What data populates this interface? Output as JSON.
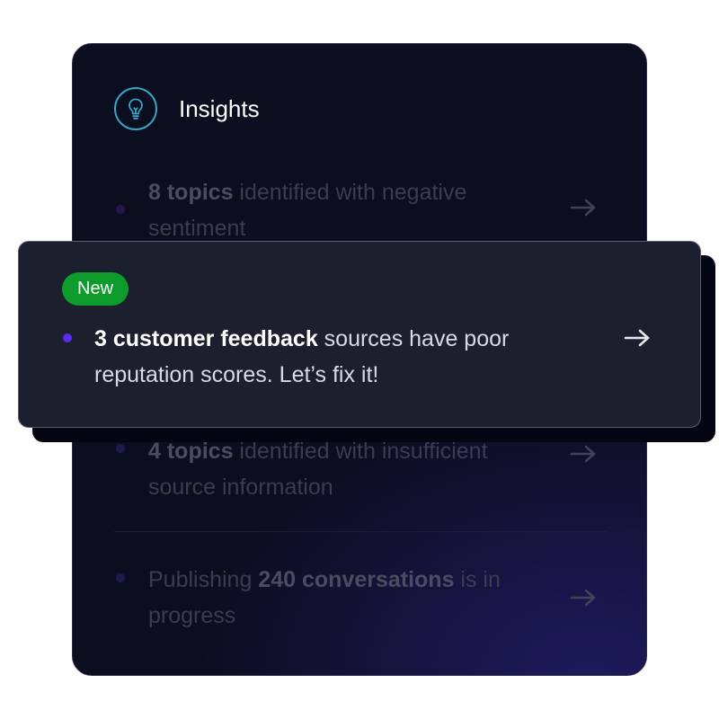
{
  "insights": {
    "title": "Insights",
    "icon": "lightbulb-icon",
    "items": [
      {
        "bold": "8 topics",
        "rest": " identified with negative sentiment",
        "state": "dimmed"
      },
      {
        "badge": "New",
        "bold": "3 customer feedback",
        "rest": " sources have poor reputation scores. Let’s fix it!",
        "state": "highlighted"
      },
      {
        "bold": "4 topics",
        "rest": " identified with insufficient source information",
        "state": "dimmed"
      },
      {
        "pre": "Publishing ",
        "bold": "240 conversations",
        "rest": " is in progress",
        "state": "dimmed"
      }
    ]
  },
  "colors": {
    "panel_bg": "#0b0e1e",
    "card_bg": "#1b1f2e",
    "badge_green": "#0d9b2c",
    "accent_purple": "#5b2cf0",
    "icon_blue": "#3aa3c6"
  }
}
